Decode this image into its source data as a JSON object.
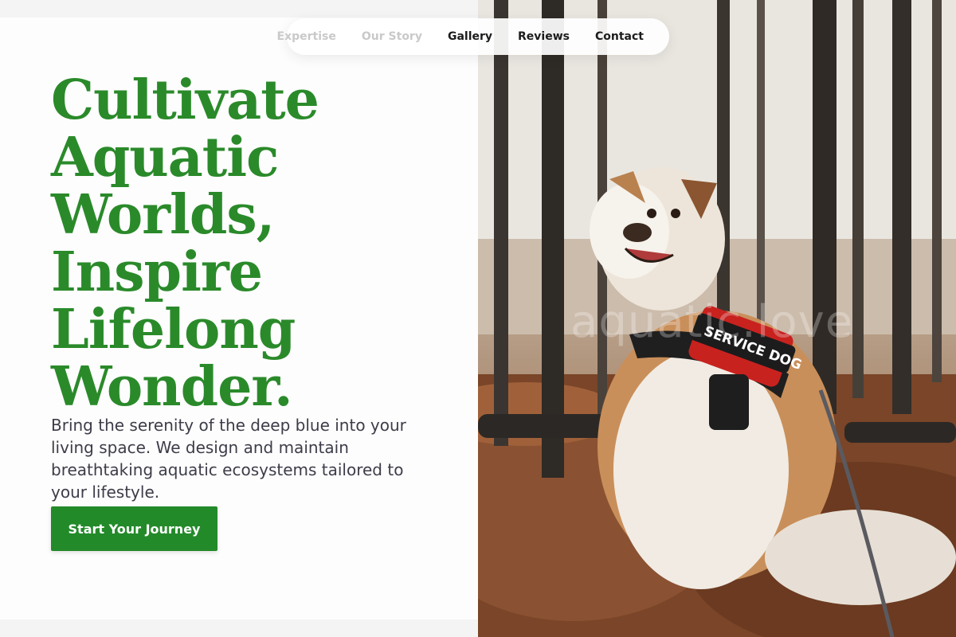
{
  "nav": {
    "items": [
      {
        "label": "Expertise"
      },
      {
        "label": "Our Story"
      },
      {
        "label": "Gallery"
      },
      {
        "label": "Reviews"
      },
      {
        "label": "Contact"
      }
    ]
  },
  "hero": {
    "headline_lines": [
      "Cultivate",
      "Aquatic",
      "Worlds,",
      "Inspire",
      "Lifelong",
      "Wonder."
    ],
    "subtitle": "Bring the serenity of the deep blue into your living space. We design and maintain breathtaking aquatic ecosystems tailored to your lifestyle.",
    "cta_label": "Start Your Journey"
  },
  "photo": {
    "watermark": "aquatic.love",
    "harness_text": "SERVICE DOG"
  },
  "colors": {
    "accent": "#2a8a2a",
    "button": "#238a2a",
    "text": "#3d3d4a"
  }
}
